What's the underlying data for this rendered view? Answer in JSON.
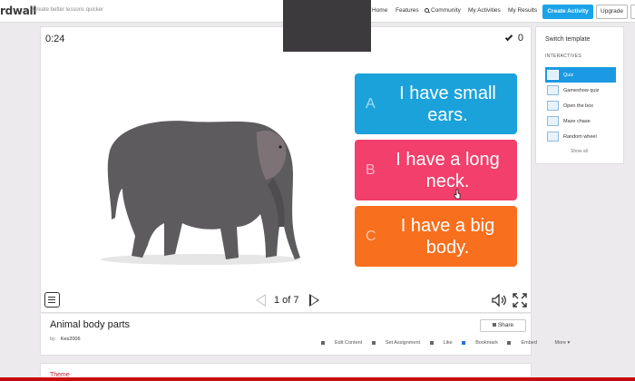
{
  "topbar": {
    "logo_text": "rdwall",
    "tagline": "Create better lessons quicker",
    "nav": [
      {
        "label": "Home"
      },
      {
        "label": "Features"
      },
      {
        "label": "Community"
      },
      {
        "label": "My Activities"
      },
      {
        "label": "My Results"
      }
    ],
    "create_label": "Create Activity",
    "upgrade_label": "Upgrade"
  },
  "game": {
    "timer": "0:24",
    "score": "0",
    "answers": [
      {
        "letter": "A",
        "text": "I have small ears.",
        "color": "#1ba2da"
      },
      {
        "letter": "B",
        "text": "I have a long neck.",
        "color": "#f23f6c"
      },
      {
        "letter": "C",
        "text": "I have a big body.",
        "color": "#f86f1e"
      }
    ],
    "page_indicator": "1 of 7"
  },
  "info": {
    "title": "Animal body parts",
    "by_label": "by",
    "author": "Kes2006",
    "share_label": "Share",
    "actions": [
      "Edit Content",
      "Set Assignment",
      "Like",
      "Bookmark",
      "Embed",
      "More"
    ]
  },
  "theme": {
    "label": "Theme"
  },
  "panel": {
    "title": "Switch template",
    "section": "INTERACTIVES",
    "templates": [
      {
        "label": "Quiz",
        "icon": "quiz-icon"
      },
      {
        "label": "Gameshow quiz",
        "icon": "gameshow-icon"
      },
      {
        "label": "Open the box",
        "icon": "box-icon"
      },
      {
        "label": "Maze chase",
        "icon": "maze-icon"
      },
      {
        "label": "Random wheel",
        "icon": "wheel-icon"
      }
    ],
    "show_all": "Show all"
  },
  "colors": {
    "accent": "#1aa3e8",
    "bottom_bar": "#c80c0c"
  }
}
